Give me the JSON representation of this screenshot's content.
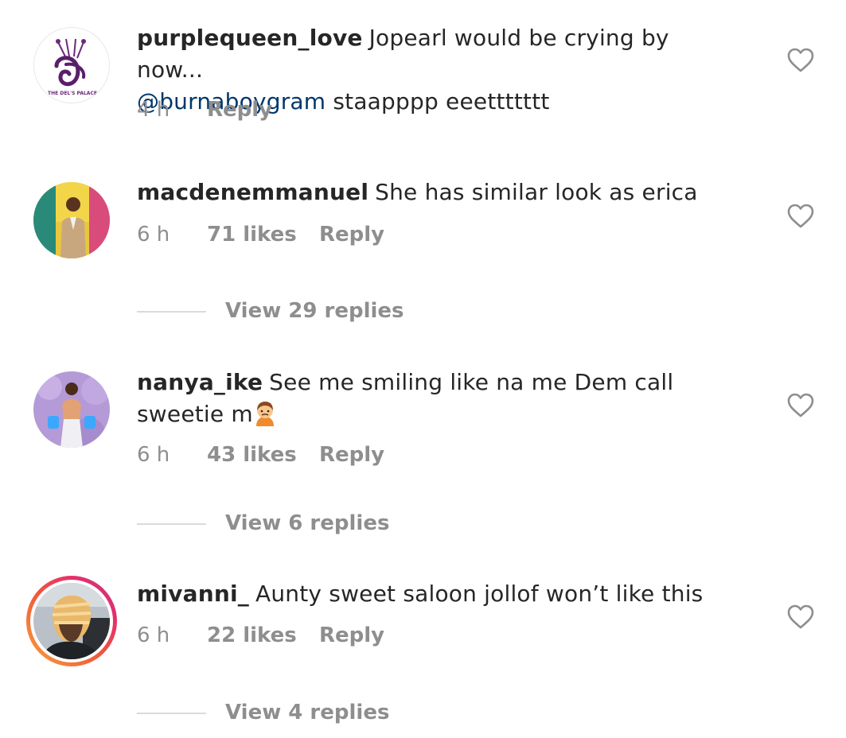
{
  "comments": [
    {
      "username": "purplequeen_love",
      "text_before": "Jopearl would be crying by now...",
      "mention": "@burnaboygram",
      "text_after": "staapppp eeettttttt",
      "time": "4 h",
      "likes": "",
      "reply_label": "Reply",
      "avatar_label": "THE DEL'S PALACE",
      "view_replies": ""
    },
    {
      "username": "macdenemmanuel",
      "text": "She has similar look as erica",
      "time": "6 h",
      "likes": "71 likes",
      "reply_label": "Reply",
      "view_replies": "View 29 replies"
    },
    {
      "username": "nanya_ike",
      "text": "See me smiling like na me Dem call sweetie m",
      "emoji": "🙍",
      "time": "6 h",
      "likes": "43 likes",
      "reply_label": "Reply",
      "view_replies": "View 6 replies"
    },
    {
      "username": "mivanni_",
      "text": "Aunty sweet saloon jollof won’t like this",
      "time": "6 h",
      "likes": "22 likes",
      "reply_label": "Reply",
      "view_replies": "View 4 replies"
    }
  ],
  "icons": {
    "like": "heart-outline-icon"
  },
  "colors": {
    "text": "#262626",
    "secondary": "#8e8e8e",
    "mention": "#00376b",
    "divider": "#dbdbdb"
  }
}
